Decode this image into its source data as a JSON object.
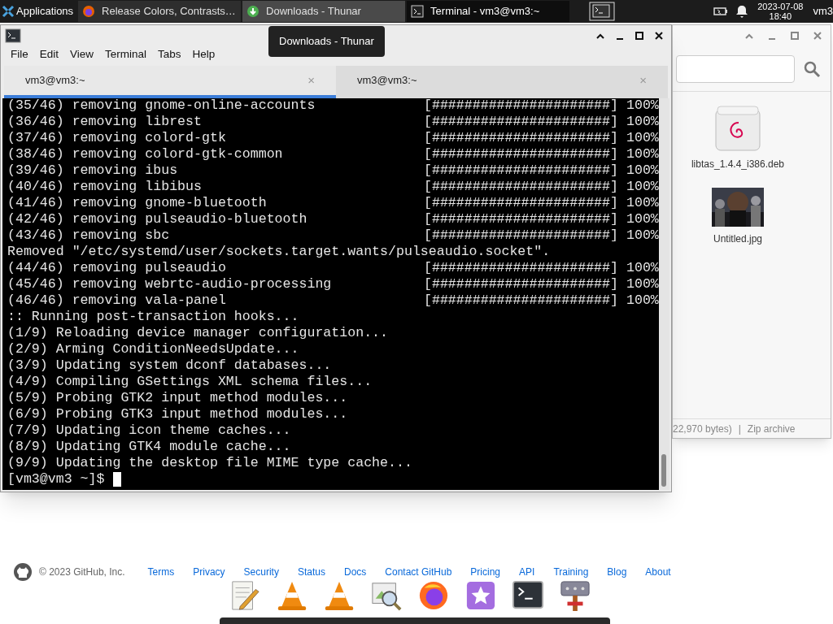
{
  "panel": {
    "apps_menu": "Applications",
    "tasks": [
      {
        "label": "Release Colors, Contrasts…",
        "kind": "browser",
        "selected": false,
        "hovered": false
      },
      {
        "label": "Downloads - Thunar",
        "kind": "download",
        "selected": false,
        "hovered": true
      },
      {
        "label": "Terminal - vm3@vm3:~",
        "kind": "terminal",
        "selected": true,
        "hovered": false
      }
    ],
    "date": "2023-07-08",
    "time": "18:40",
    "user": "vm3"
  },
  "tooltip": "Downloads - Thunar",
  "terminal": {
    "menu": [
      "File",
      "Edit",
      "View",
      "Terminal",
      "Tabs",
      "Help"
    ],
    "tabs": [
      {
        "label": "vm3@vm3:~",
        "close": "×",
        "selected": true
      },
      {
        "label": "vm3@vm3:~",
        "close": "×",
        "selected": false
      }
    ],
    "lines": [
      {
        "text": "(35/46) removing gnome-online-accounts",
        "progress": "[######################]",
        "percent": "100%"
      },
      {
        "text": "(36/46) removing librest",
        "progress": "[######################]",
        "percent": "100%"
      },
      {
        "text": "(37/46) removing colord-gtk",
        "progress": "[######################]",
        "percent": "100%"
      },
      {
        "text": "(38/46) removing colord-gtk-common",
        "progress": "[######################]",
        "percent": "100%"
      },
      {
        "text": "(39/46) removing ibus",
        "progress": "[######################]",
        "percent": "100%"
      },
      {
        "text": "(40/46) removing libibus",
        "progress": "[######################]",
        "percent": "100%"
      },
      {
        "text": "(41/46) removing gnome-bluetooth",
        "progress": "[######################]",
        "percent": "100%"
      },
      {
        "text": "(42/46) removing pulseaudio-bluetooth",
        "progress": "[######################]",
        "percent": "100%"
      },
      {
        "text": "(43/46) removing sbc",
        "progress": "[######################]",
        "percent": "100%"
      },
      {
        "text": "Removed \"/etc/systemd/user/sockets.target.wants/pulseaudio.socket\"."
      },
      {
        "text": "(44/46) removing pulseaudio",
        "progress": "[######################]",
        "percent": "100%"
      },
      {
        "text": "(45/46) removing webrtc-audio-processing",
        "progress": "[######################]",
        "percent": "100%"
      },
      {
        "text": "(46/46) removing vala-panel",
        "progress": "[######################]",
        "percent": "100%"
      },
      {
        "text": ":: Running post-transaction hooks..."
      },
      {
        "text": "(1/9) Reloading device manager configuration..."
      },
      {
        "text": "(2/9) Arming ConditionNeedsUpdate..."
      },
      {
        "text": "(3/9) Updating system dconf databases..."
      },
      {
        "text": "(4/9) Compiling GSettings XML schema files..."
      },
      {
        "text": "(5/9) Probing GTK2 input method modules..."
      },
      {
        "text": "(6/9) Probing GTK3 input method modules..."
      },
      {
        "text": "(7/9) Updating icon theme caches..."
      },
      {
        "text": "(8/9) Updating GTK4 module cache..."
      },
      {
        "text": "(9/9) Updating the desktop file MIME type cache..."
      }
    ],
    "prompt": "[vm3@vm3 ~]$"
  },
  "file_manager": {
    "files": [
      {
        "name": "libtas_1.4.4_i386.deb",
        "kind": "package"
      },
      {
        "name": "Untitled.jpg",
        "kind": "picture"
      }
    ],
    "status_size": "22,970 bytes)",
    "status_sep": "|",
    "status_type": "Zip archive"
  },
  "footer": {
    "copyright": "© 2023 GitHub, Inc.",
    "links": [
      "Terms",
      "Privacy",
      "Security",
      "Status",
      "Docs",
      "Contact GitHub",
      "Pricing",
      "API",
      "Training",
      "Blog",
      "About"
    ]
  },
  "dock": [
    {
      "kind": "editor"
    },
    {
      "kind": "cone"
    },
    {
      "kind": "cone"
    },
    {
      "kind": "viewer"
    },
    {
      "kind": "browser"
    },
    {
      "kind": "star"
    },
    {
      "kind": "terminal"
    },
    {
      "kind": "network"
    }
  ]
}
